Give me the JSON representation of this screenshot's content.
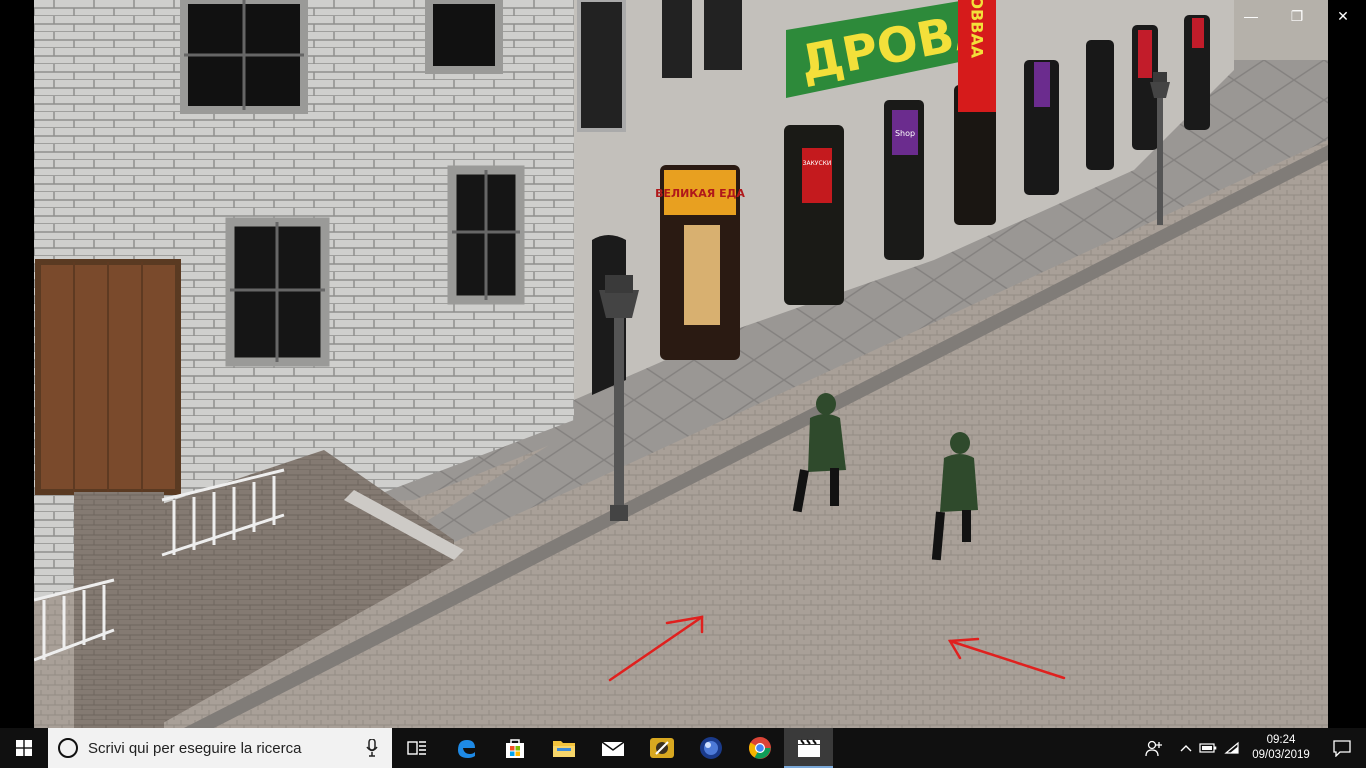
{
  "window": {
    "controls": {
      "minimize": "—",
      "maximize": "❐",
      "close": "✕"
    }
  },
  "scene": {
    "signs": {
      "banner": "ДРОВА",
      "vertical": "ООВВАА",
      "shop_orange": "ВЕЛИКАЯ ЕДА",
      "shop_red": "ЗАКУСКИ",
      "shop_purple": "Shop"
    },
    "colors": {
      "uniform": "#2f4a2c",
      "arrow": "#e0201e",
      "banner": "#2d8a3a",
      "banner_text": "#f3e03a"
    }
  },
  "taskbar": {
    "search_placeholder": "Scrivi qui per eseguire la ricerca",
    "apps": [
      {
        "name": "task-view",
        "icon": "task-view-icon"
      },
      {
        "name": "edge",
        "icon": "edge-icon"
      },
      {
        "name": "store",
        "icon": "store-icon"
      },
      {
        "name": "file-explorer",
        "icon": "folder-icon"
      },
      {
        "name": "mail",
        "icon": "mail-icon"
      },
      {
        "name": "app-yellow",
        "icon": "app-icon"
      },
      {
        "name": "cinema4d",
        "icon": "sphere-icon"
      },
      {
        "name": "chrome",
        "icon": "chrome-icon"
      },
      {
        "name": "movies",
        "icon": "clapperboard-icon",
        "active": true
      }
    ],
    "tray": {
      "time": "09:24",
      "date": "09/03/2019"
    }
  }
}
